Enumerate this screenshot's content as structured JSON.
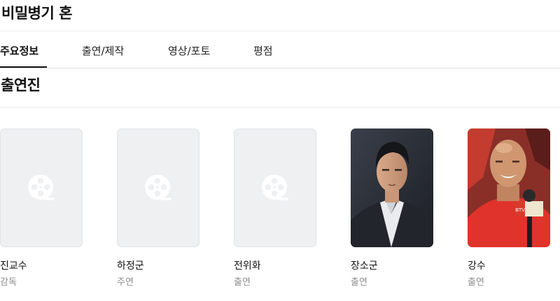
{
  "movie": {
    "title": "비밀병기 혼"
  },
  "tabs": [
    {
      "label": "주요정보",
      "active": true
    },
    {
      "label": "출연/제작",
      "active": false
    },
    {
      "label": "영상/포토",
      "active": false
    },
    {
      "label": "평점",
      "active": false
    }
  ],
  "section": {
    "title": "출연진"
  },
  "cast": [
    {
      "name": "진교수",
      "role": "감독",
      "photo": "placeholder-film-reel-icon"
    },
    {
      "name": "하정군",
      "role": "주연",
      "photo": "placeholder-film-reel-icon"
    },
    {
      "name": "전위화",
      "role": "출연",
      "photo": "placeholder-film-reel-icon"
    },
    {
      "name": "장소군",
      "role": "출연",
      "photo": "portrait-man-in-suit"
    },
    {
      "name": "강수",
      "role": "출연",
      "photo": "portrait-man-with-microphone"
    }
  ],
  "colors": {
    "placeholder_bg": "#eef0f2",
    "role_text": "#8e8e8e",
    "active_tab_underline": "#111111"
  }
}
